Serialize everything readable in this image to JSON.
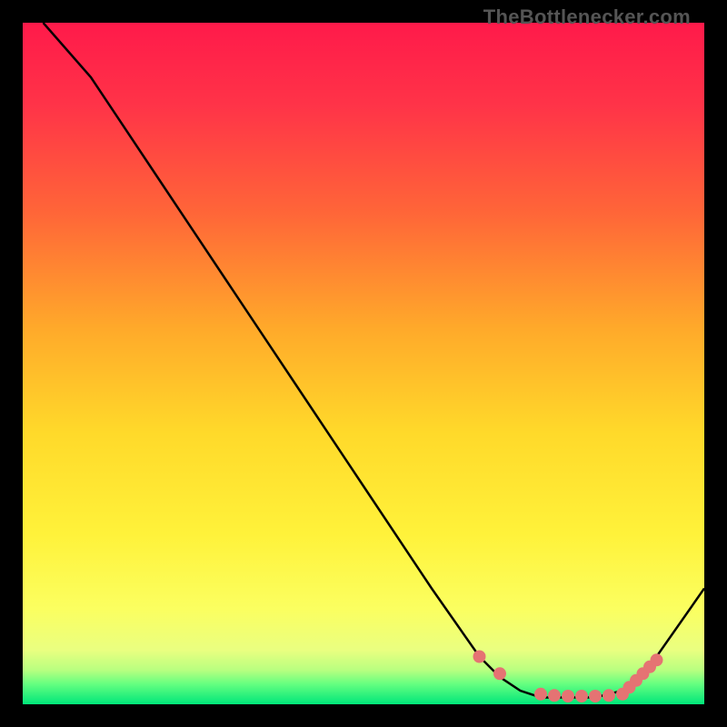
{
  "watermark": "TheBottlenecker.com",
  "chart_data": {
    "type": "line",
    "title": "",
    "xlabel": "",
    "ylabel": "",
    "xlim": [
      0,
      100
    ],
    "ylim": [
      0,
      100
    ],
    "background_gradient": {
      "top": "#ff1744",
      "mid_upper": "#ff9800",
      "mid": "#ffeb3b",
      "mid_lower": "#ffff8d",
      "bottom": "#00e676"
    },
    "series": [
      {
        "name": "bottleneck-curve",
        "x": [
          3,
          10,
          20,
          30,
          40,
          50,
          60,
          67,
          70,
          73,
          76,
          80,
          84,
          88,
          90,
          93,
          100
        ],
        "y": [
          100,
          92,
          77,
          62,
          47,
          32,
          17,
          7,
          4,
          2,
          1,
          1,
          1,
          2,
          4,
          7,
          17
        ]
      }
    ],
    "markers": {
      "name": "data-points",
      "color": "#e57373",
      "x": [
        67,
        70,
        76,
        78,
        80,
        82,
        84,
        86,
        88,
        89,
        90,
        91,
        92,
        93
      ],
      "y": [
        7,
        4.5,
        1.5,
        1.3,
        1.2,
        1.2,
        1.2,
        1.3,
        1.5,
        2.5,
        3.5,
        4.5,
        5.5,
        6.5
      ]
    }
  }
}
